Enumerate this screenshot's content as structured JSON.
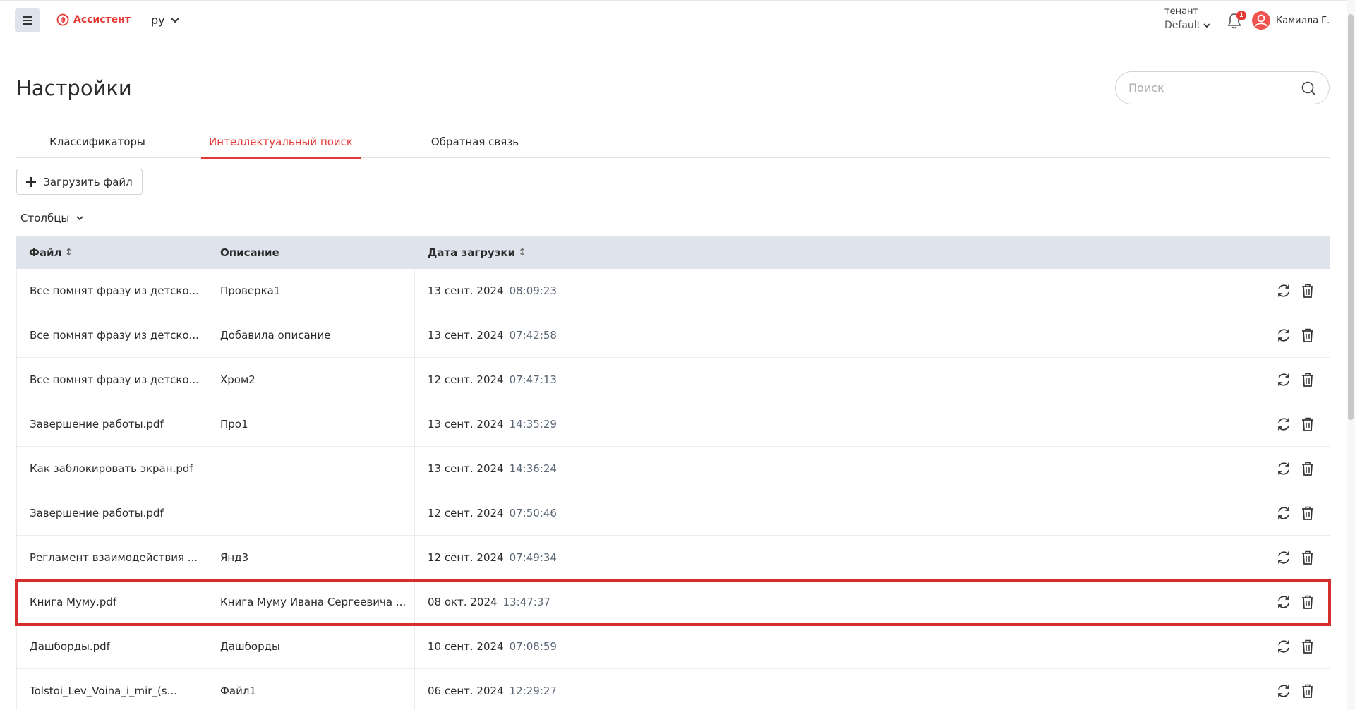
{
  "header": {
    "brand": "Ассистент",
    "language": "ру",
    "tenant_label": "тенант",
    "tenant_value": "Default",
    "notifications_count": "1",
    "user_name": "Камилла Г."
  },
  "page": {
    "title": "Настройки",
    "search_placeholder": "Поиск"
  },
  "tabs": [
    {
      "label": "Классификаторы",
      "active": false
    },
    {
      "label": "Интеллектуальный поиск",
      "active": true
    },
    {
      "label": "Обратная связь",
      "active": false
    }
  ],
  "toolbar": {
    "upload_label": "Загрузить файл",
    "columns_label": "Столбцы"
  },
  "table": {
    "headers": {
      "file": "Файл",
      "description": "Описание",
      "date": "Дата загрузки"
    },
    "sort_glyph": "↕",
    "rows": [
      {
        "file": "Все помнят фразу из детско...",
        "description": "Проверка1",
        "date": "13 сент. 2024",
        "time": "08:09:23"
      },
      {
        "file": "Все помнят фразу из детско...",
        "description": "Добавила описание",
        "date": "13 сент. 2024",
        "time": "07:42:58"
      },
      {
        "file": "Все помнят фразу из детско...",
        "description": "Хром2",
        "date": "12 сент. 2024",
        "time": "07:47:13"
      },
      {
        "file": "Завершение работы.pdf",
        "description": "Про1",
        "date": "13 сент. 2024",
        "time": "14:35:29"
      },
      {
        "file": "Как заблокировать экран.pdf",
        "description": "",
        "date": "13 сент. 2024",
        "time": "14:36:24"
      },
      {
        "file": "Завершение работы.pdf",
        "description": "",
        "date": "12 сент. 2024",
        "time": "07:50:46"
      },
      {
        "file": "Регламент взаимодействия ...",
        "description": "Янд3",
        "date": "12 сент. 2024",
        "time": "07:49:34"
      },
      {
        "file": "Книга Муму.pdf",
        "description": "Книга Муму Ивана Сергеевича ...",
        "date": "08 окт. 2024",
        "time": "13:47:37"
      },
      {
        "file": "Дашборды.pdf",
        "description": "Дашборды",
        "date": "10 сент. 2024",
        "time": "07:08:59"
      },
      {
        "file": "Tolstoi_Lev_Voina_i_mir_(s...",
        "description": "Файл1",
        "date": "06 сент. 2024",
        "time": "12:29:27"
      }
    ],
    "highlighted_row_index": 7
  },
  "colors": {
    "accent": "#e53935",
    "header_bg": "#dfe4ec",
    "highlight": "#d32f2f"
  }
}
